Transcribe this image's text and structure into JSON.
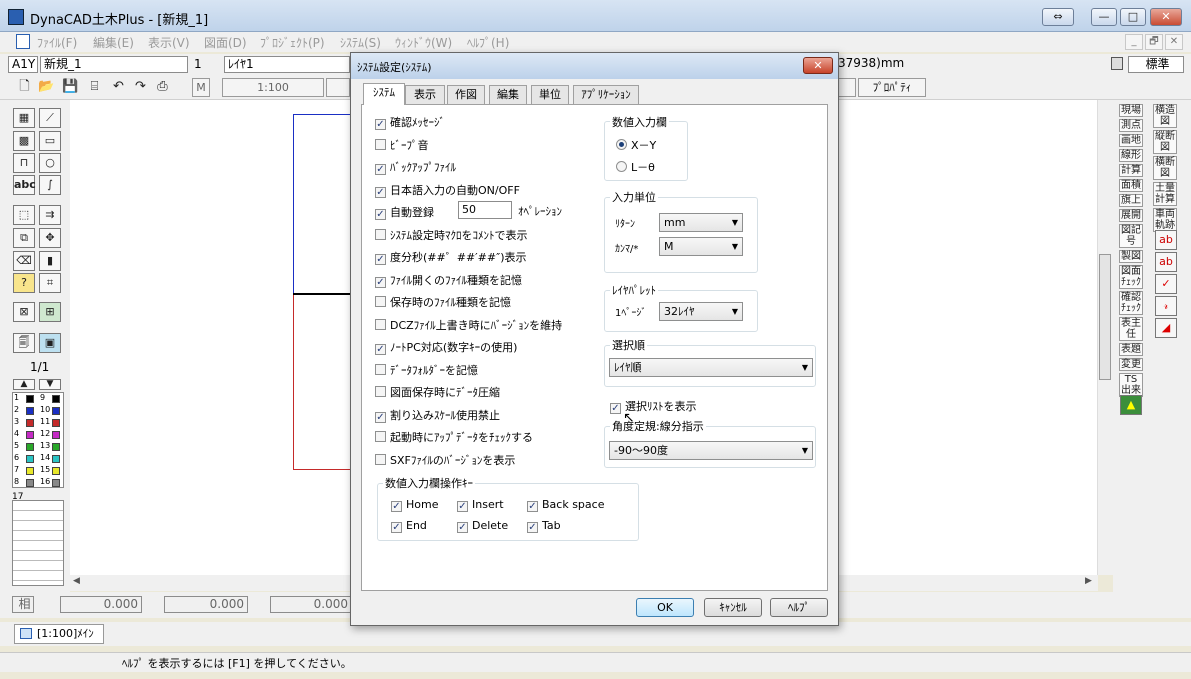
{
  "window": {
    "title": "DynaCAD土木Plus - [新規_1]",
    "restore_label": "⇔",
    "min_label": "—",
    "max_label": "□",
    "close_label": "✕"
  },
  "menu": [
    "ﾌｧｲﾙ(F)",
    "編集(E)",
    "表示(V)",
    "図面(D)",
    "ﾌﾟﾛｼﾞｪｸﾄ(P)",
    "ｼｽﾃﾑ(S)",
    "ｳｨﾝﾄﾞｳ(W)",
    "ﾍﾙﾌﾟ(H)"
  ],
  "mdi": {
    "min": "_",
    "restore": "🗗",
    "close": "✕"
  },
  "statusrow": {
    "sheet": "A1Y",
    "name": "新規_1",
    "num": "1",
    "layer": "ﾚｲﾔ1",
    "coord_tail": "37938)mm",
    "std": "標準"
  },
  "toolbar": {
    "scale": "1:100",
    "prop": "ﾌﾟﾛﾊﾟﾃｨ",
    "m": "M"
  },
  "palette": {
    "page": "1/1",
    "colors": [
      "1",
      "2",
      "3",
      "4",
      "5",
      "6",
      "7",
      "8",
      "9",
      "10",
      "11",
      "12",
      "13",
      "14",
      "15",
      "16"
    ],
    "col17": "17"
  },
  "right_palette": {
    "col1": [
      "現場",
      "測点",
      "画地",
      "線形",
      "計算",
      "面積",
      "旗上",
      "展開",
      "図記号",
      "製図",
      "図面ﾁｪｯｸ",
      "確認ﾁｪｯｸ",
      "表主任",
      "表題",
      "変更",
      "TS出来"
    ],
    "col2": [
      "横造図",
      "縦断図",
      "横断図",
      "土量計算",
      "車両軌跡"
    ]
  },
  "coords": {
    "label": "相",
    "v1": "0.000",
    "v2": "0.000",
    "v3": "0.000"
  },
  "doc_tab": "[1:100]ﾒｲﾝ",
  "statusbar": "ﾍﾙﾌﾟ を表示するには [F1] を押してください。",
  "dialog": {
    "title": "ｼｽﾃﾑ設定(ｼｽﾃﾑ)",
    "close": "✕",
    "tabs": [
      "ｼｽﾃﾑ",
      "表示",
      "作図",
      "編集",
      "単位",
      "ｱﾌﾟﾘｹｰｼｮﾝ"
    ],
    "checks": [
      {
        "label": "確認ﾒｯｾｰｼﾞ",
        "on": true
      },
      {
        "label": "ﾋﾞｰﾌﾟ音",
        "on": false
      },
      {
        "label": "ﾊﾞｯｸｱｯﾌﾟﾌｧｲﾙ",
        "on": true
      },
      {
        "label": "日本語入力の自動ON/OFF",
        "on": true
      },
      {
        "label": "自動登録",
        "on": true
      },
      {
        "label": "ｼｽﾃﾑ設定時ﾏｸﾛをｺﾒﾝﾄで表示",
        "on": false
      },
      {
        "label": "度分秒(##゜##′##″)表示",
        "on": true
      },
      {
        "label": "ﾌｧｲﾙ開くのﾌｧｲﾙ種類を記憶",
        "on": true
      },
      {
        "label": "保存時のﾌｧｲﾙ種類を記憶",
        "on": false
      },
      {
        "label": "DCZﾌｧｲﾙ上書き時にﾊﾞｰｼﾞｮﾝを維持",
        "on": false
      },
      {
        "label": "ﾉｰﾄPC対応(数字ｷｰの使用)",
        "on": true
      },
      {
        "label": "ﾃﾞｰﾀﾌｫﾙﾀﾞｰを記憶",
        "on": false
      },
      {
        "label": "図面保存時にﾃﾞｰﾀ圧縮",
        "on": false
      },
      {
        "label": "割り込みｽｹｰﾙ使用禁止",
        "on": true
      },
      {
        "label": "起動時にｱｯﾌﾟﾃﾞｰﾀをﾁｪｯｸする",
        "on": false
      },
      {
        "label": "SXFﾌｧｲﾙのﾊﾞｰｼﾞｮﾝを表示",
        "on": false
      }
    ],
    "auto_save_value": "50",
    "auto_save_unit": "ｵﾍﾟﾚｰｼｮﾝ",
    "numeric_input": {
      "label": "数値入力欄",
      "opt1": "X－Y",
      "opt2": "L－θ",
      "selected": "X－Y"
    },
    "input_unit": {
      "label": "入力単位",
      "return_label": "ﾘﾀｰﾝ",
      "return_value": "mm",
      "comma_label": "ｶﾝﾏ/*",
      "comma_value": "M"
    },
    "layer_palette": {
      "label": "ﾚｲﾔﾊﾟﾚｯﾄ",
      "page_label": "1ﾍﾟｰｼﾞ",
      "page_value": "32ﾚｲﾔ"
    },
    "select_order": {
      "label": "選択順",
      "value": "ﾚｲﾔ順"
    },
    "show_select_list": {
      "label": "選択ﾘｽﾄを表示",
      "on": true
    },
    "angle": {
      "label": "角度定規:線分指示",
      "value": "-90～90度"
    },
    "keys": {
      "label": "数値入力欄操作ｷｰ",
      "items": [
        {
          "label": "Home",
          "on": true
        },
        {
          "label": "Insert",
          "on": true
        },
        {
          "label": "Back space",
          "on": true
        },
        {
          "label": "End",
          "on": true
        },
        {
          "label": "Delete",
          "on": true
        },
        {
          "label": "Tab",
          "on": true
        }
      ]
    },
    "buttons": {
      "ok": "OK",
      "cancel": "ｷｬﾝｾﾙ",
      "help": "ﾍﾙﾌﾟ"
    }
  }
}
